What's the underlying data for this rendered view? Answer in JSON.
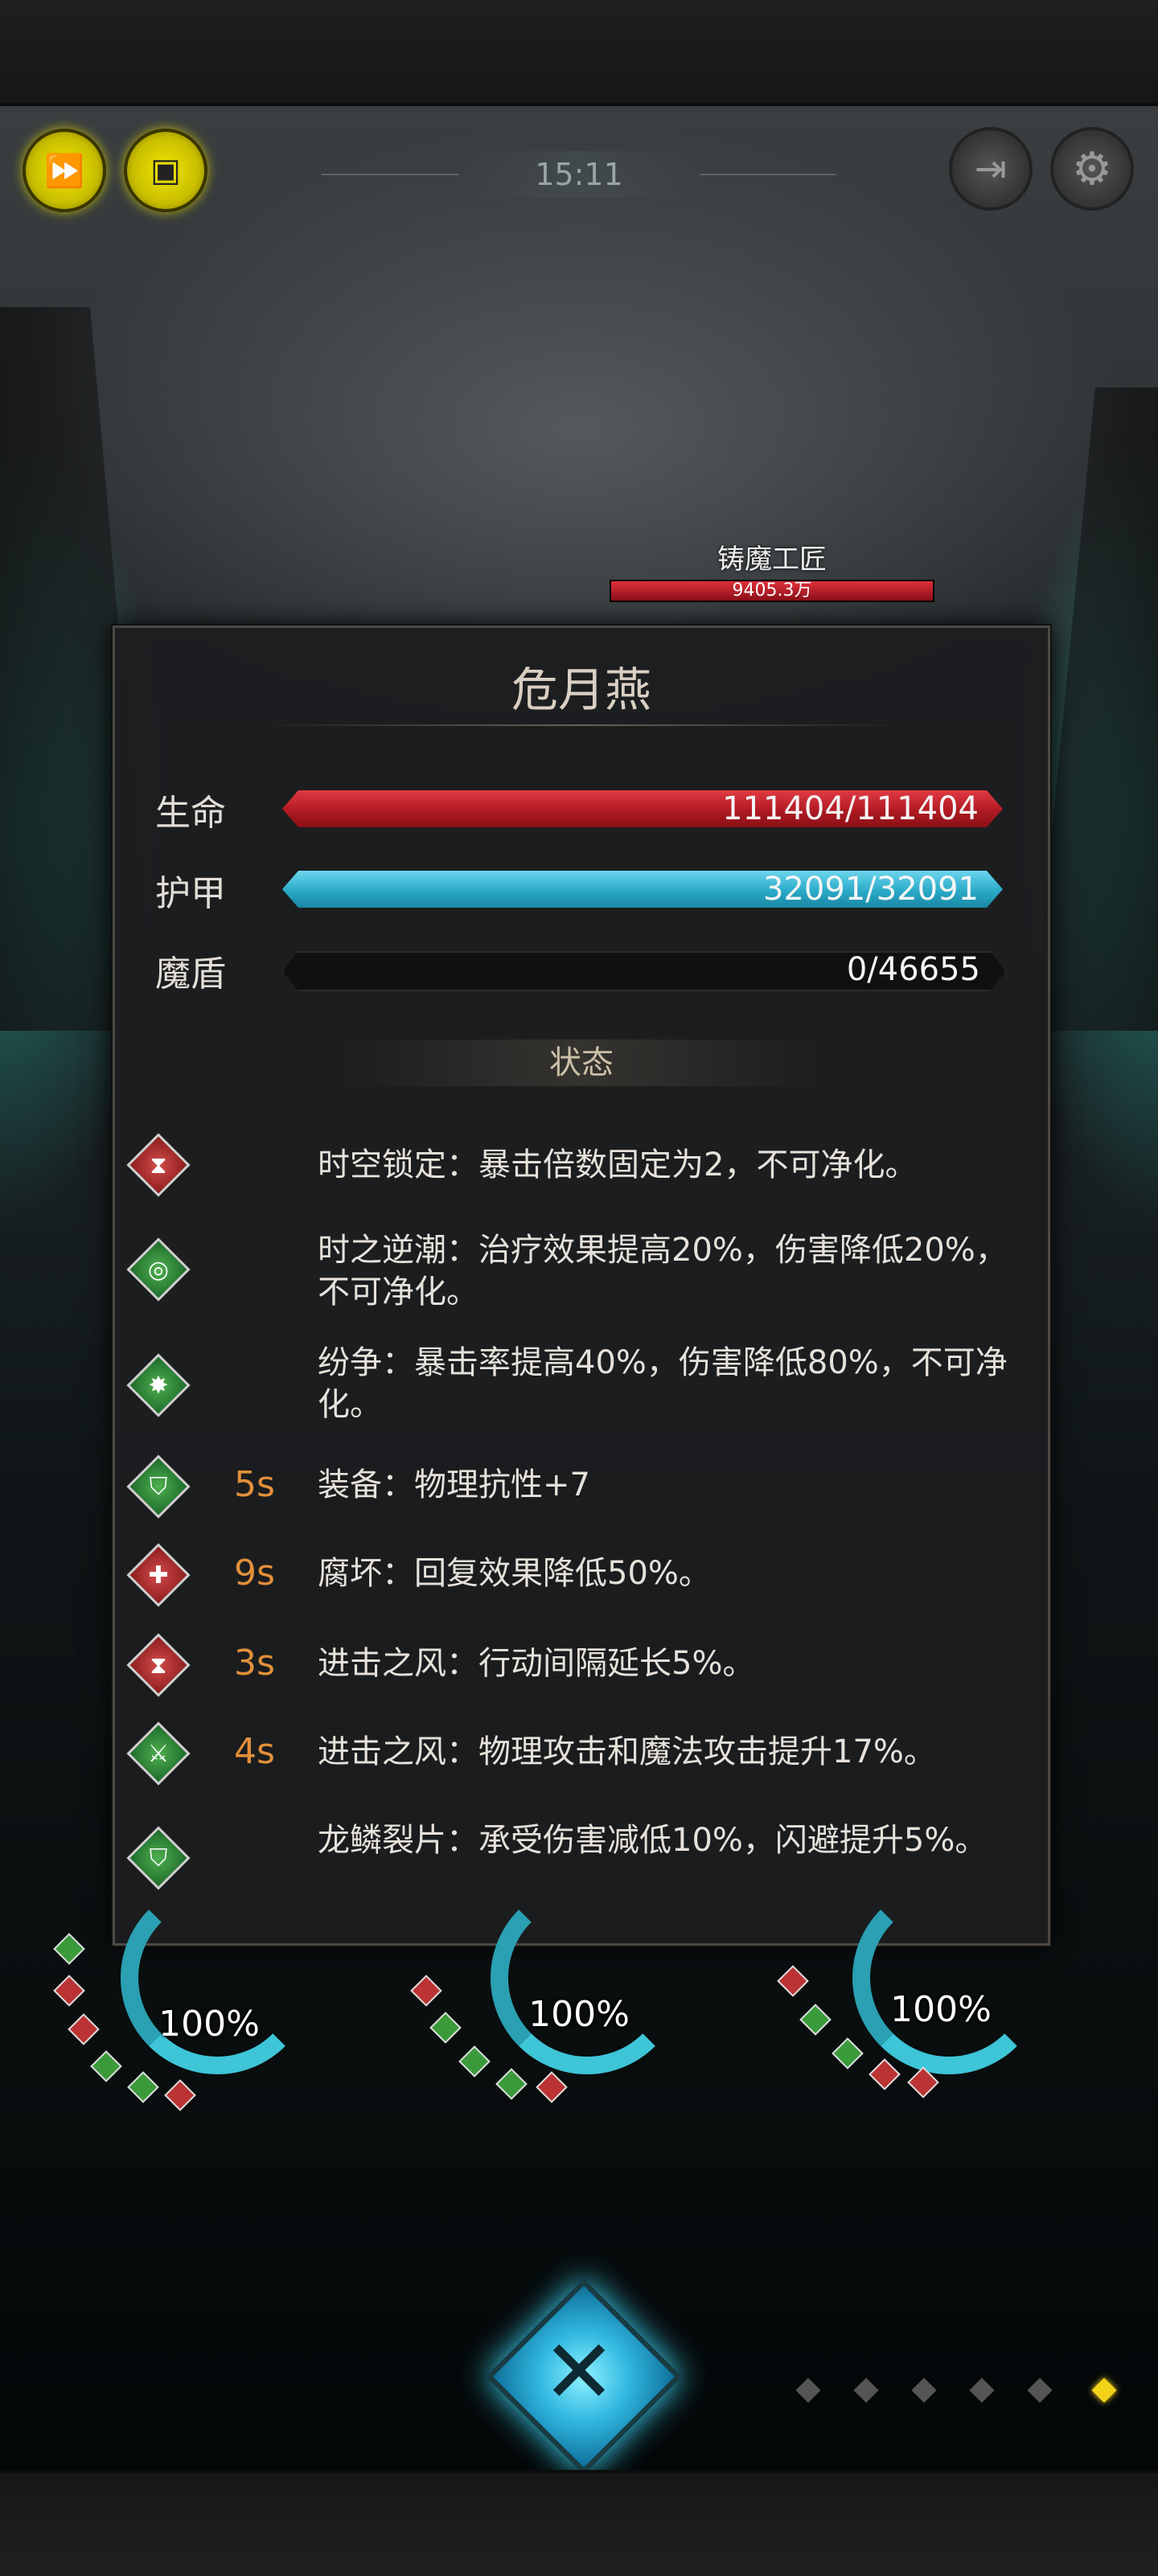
{
  "hud": {
    "timer": "15:11",
    "icons": [
      "fast-forward-icon",
      "auto-battle-icon",
      "exit-icon",
      "gear-icon"
    ]
  },
  "boss": {
    "name": "铸魔工匠",
    "hp_text": "9405.3万"
  },
  "panel": {
    "title": "危月燕",
    "stats": {
      "hp": {
        "label": "生命",
        "value": "111404/111404"
      },
      "armor": {
        "label": "护甲",
        "value": "32091/32091"
      },
      "magic_shield": {
        "label": "魔盾",
        "value": "0/46655"
      }
    },
    "section_title": "状态",
    "effects": [
      {
        "icon": "hourglass-icon",
        "color": "red",
        "duration": "",
        "text": "时空锁定：暴击倍数固定为2，不可净化。"
      },
      {
        "icon": "swirl-icon",
        "color": "green",
        "duration": "",
        "text": "时之逆潮：治疗效果提高20%，伤害降低20%，不可净化。"
      },
      {
        "icon": "claw-icon",
        "color": "green",
        "duration": "",
        "text": "纷争：暴击率提高40%，伤害降低80%，不可净化。"
      },
      {
        "icon": "shield-icon",
        "color": "green",
        "duration": "5s",
        "text": "装备：物理抗性+7"
      },
      {
        "icon": "broken-cross-icon",
        "color": "red",
        "duration": "9s",
        "text": "腐坏：回复效果降低50%。"
      },
      {
        "icon": "hourglass-icon",
        "color": "red",
        "duration": "3s",
        "text": "进击之风：行动间隔延长5%。"
      },
      {
        "icon": "swords-up-icon",
        "color": "green",
        "duration": "4s",
        "text": "进击之风：物理攻击和魔法攻击提升17%。"
      },
      {
        "icon": "shield-icon",
        "color": "green",
        "duration": "",
        "text": "龙鳞裂片：承受伤害减低10%，闪避提升5%。"
      }
    ]
  },
  "heroes": [
    {
      "percent": "100%"
    },
    {
      "percent": "100%"
    },
    {
      "percent": "100%"
    }
  ],
  "colors": {
    "hp": "#c4222c",
    "armor": "#2aaac8",
    "duration": "#e2903a",
    "accent": "#f3d21a"
  }
}
